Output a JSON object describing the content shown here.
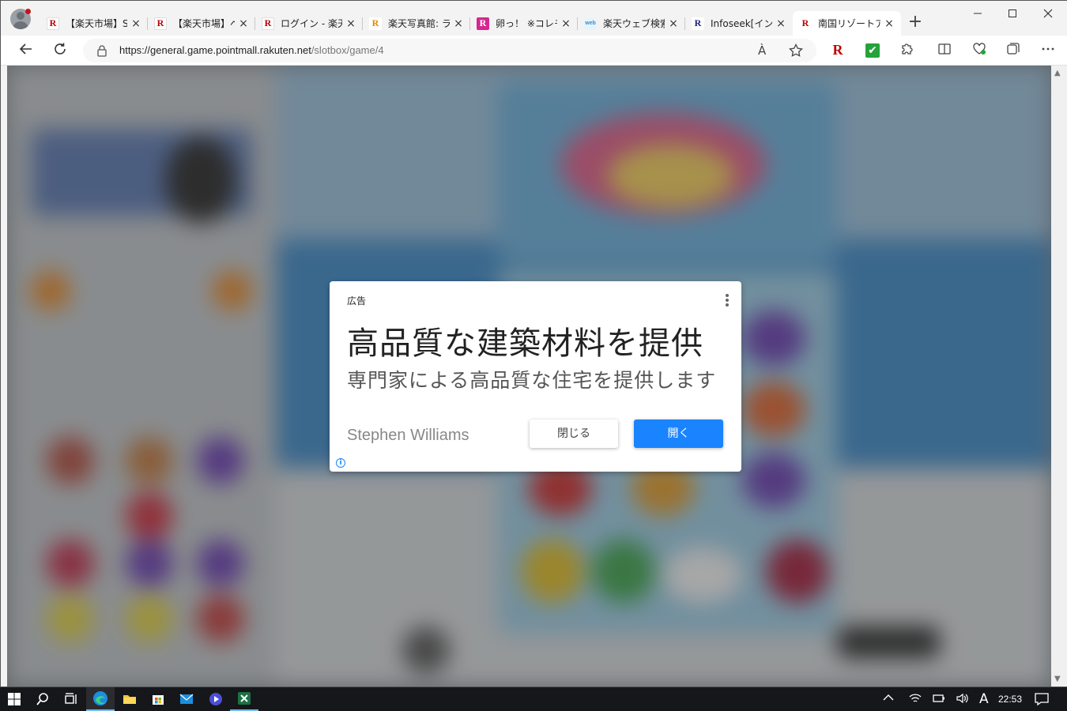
{
  "browser": {
    "tabs": [
      {
        "title": "【楽天市場】Sh",
        "favicon": "rakuten-r-icon"
      },
      {
        "title": "【楽天市場】ベ",
        "favicon": "rakuten-r-icon"
      },
      {
        "title": "ログイン - 楽天",
        "favicon": "rakuten-r-icon"
      },
      {
        "title": "楽天写真館: ラ",
        "favicon": "rakuten-photo-icon"
      },
      {
        "title": "卵っ！ ※コレモ",
        "favicon": "rakuten-pink-icon"
      },
      {
        "title": "楽天ウェブ検索",
        "favicon": "web-search-icon"
      },
      {
        "title": "Infoseek[インフ",
        "favicon": "infoseek-icon"
      },
      {
        "title": "南国リゾートアプ",
        "favicon": "rakuten-r-icon"
      }
    ],
    "new_tab_label": "+",
    "url_host": "https://general.game.pointmall.rakuten.net",
    "url_path": "/slotbox/game/4",
    "read_aloud_label": "À",
    "ext_rakuten_label": "R",
    "ext_check_label": "✔"
  },
  "ad": {
    "label": "広告",
    "headline": "高品質な建築材料を提供",
    "description": "専門家による高品質な住宅を提供します",
    "advertiser": "Stephen Williams",
    "close_button": "閉じる",
    "open_button": "開く",
    "info_icon": "i"
  },
  "taskbar": {
    "ime_label": "A",
    "clock": "22:53"
  }
}
